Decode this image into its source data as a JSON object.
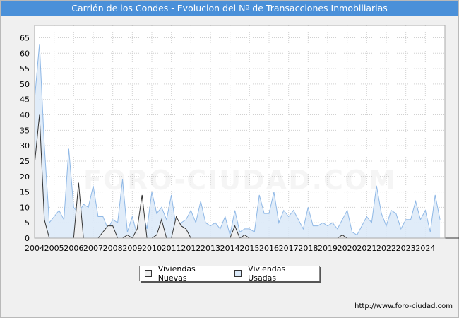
{
  "title": "Carrión de los Condes - Evolucion del Nº de Transacciones Inmobiliarias",
  "footer_url": "http://www.foro-ciudad.com",
  "watermark": "FORO-CIUDAD.COM",
  "colors": {
    "nuevas_fill": "#efefef",
    "nuevas_line": "#333333",
    "usadas_fill": "#dbe9f8",
    "usadas_line": "#8fb8e6",
    "title_bg": "#4a90d9",
    "grid": "#d0d0d0"
  },
  "chart_data": {
    "type": "area",
    "title": "Carrión de los Condes - Evolucion del Nº de Transacciones Inmobiliarias",
    "x_unit": "quarter",
    "x_start": "2004-Q1",
    "x_ticks": [
      "2004",
      "2005",
      "2006",
      "2007",
      "2008",
      "2009",
      "2010",
      "2011",
      "2012",
      "2013",
      "2014",
      "2015",
      "2016",
      "2017",
      "2018",
      "2019",
      "2020",
      "2021",
      "2022",
      "2023",
      "2024"
    ],
    "y_ticks": [
      0,
      5,
      10,
      15,
      20,
      25,
      30,
      35,
      40,
      45,
      50,
      55,
      60,
      65
    ],
    "ylim": [
      0,
      69
    ],
    "grid": true,
    "legend_position": "bottom-center",
    "series": [
      {
        "name": "Viviendas Nuevas",
        "values": [
          24,
          40,
          6,
          0,
          0,
          0,
          0,
          0,
          0,
          18,
          0,
          0,
          0,
          0,
          2,
          4,
          4,
          0,
          0,
          1,
          0,
          3,
          14,
          0,
          0,
          1,
          6,
          0,
          0,
          7,
          4,
          3,
          0,
          0,
          0,
          0,
          0,
          0,
          0,
          0,
          0,
          4,
          0,
          1,
          0,
          0,
          0,
          0,
          0,
          0,
          0,
          0,
          0,
          0,
          0,
          0,
          0,
          0,
          0,
          0,
          0,
          0,
          0,
          1,
          0,
          0,
          0,
          0,
          0,
          0,
          0,
          0,
          0,
          0,
          0,
          0,
          0,
          0,
          0,
          0,
          0,
          0,
          0,
          0,
          0,
          0,
          0,
          0,
          0,
          0,
          1,
          0,
          0,
          0,
          0,
          0,
          0,
          0,
          0,
          0,
          0,
          0,
          0,
          0,
          0,
          1,
          4,
          0
        ]
      },
      {
        "name": "Viviendas Usadas",
        "values": [
          45,
          63,
          30,
          5,
          7,
          9,
          6,
          29,
          10,
          8,
          11,
          10,
          17,
          7,
          7,
          3,
          6,
          5,
          19,
          2,
          7,
          1,
          9,
          3,
          15,
          8,
          10,
          6,
          14,
          3,
          5,
          6,
          9,
          5,
          12,
          5,
          4,
          5,
          3,
          7,
          1,
          9,
          2,
          3,
          3,
          2,
          14,
          8,
          8,
          15,
          5,
          9,
          7,
          9,
          6,
          3,
          10,
          4,
          4,
          5,
          4,
          5,
          3,
          6,
          9,
          2,
          1,
          4,
          7,
          5,
          17,
          8,
          4,
          9,
          8,
          3,
          6,
          6,
          12,
          6,
          9,
          2,
          14,
          6
        ]
      }
    ]
  }
}
